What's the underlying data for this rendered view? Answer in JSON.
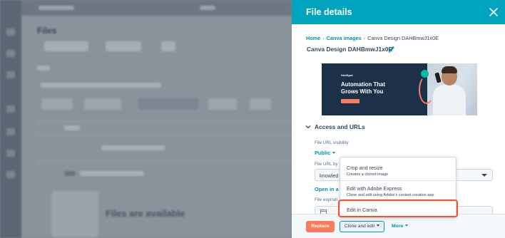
{
  "background": {
    "page_title": "Files",
    "empty_state_title": "Files are available"
  },
  "panel": {
    "title": "File details",
    "close_icon": "close-icon",
    "breadcrumb": {
      "home": "Home",
      "folder": "Canva images",
      "current": "Canva Design DAHBmwJ1x0E"
    },
    "file_name": "Canva Design DAHBmwJ1x0E",
    "edit_icon": "pencil-icon",
    "thumbnail": {
      "brand": "HubSpot",
      "headline": "Automation That Grows With You"
    },
    "access_section": {
      "label": "Access and URLs",
      "expanded": true,
      "visibility_label": "File URL visibility",
      "visibility_value": "Public",
      "url_by_label": "File URL by",
      "url_by_value": "knowled",
      "open_link": "Open in a",
      "expiration_label": "File expirati"
    }
  },
  "footer": {
    "replace": "Replace",
    "clone_and_edit": "Clone and edit",
    "more": "More"
  },
  "menu": {
    "items": [
      {
        "title": "Crop and resize",
        "description": "Creates a cloned image"
      },
      {
        "title": "Edit with Adobe Express",
        "description": "Clone and edit using Adobe's content creation app"
      },
      {
        "title": "Edit in Canva",
        "description": ""
      }
    ]
  },
  "colors": {
    "header": "#00a4bd",
    "link": "#0091ae",
    "primary_button": "#ff7a59",
    "highlight": "#e8572e"
  }
}
